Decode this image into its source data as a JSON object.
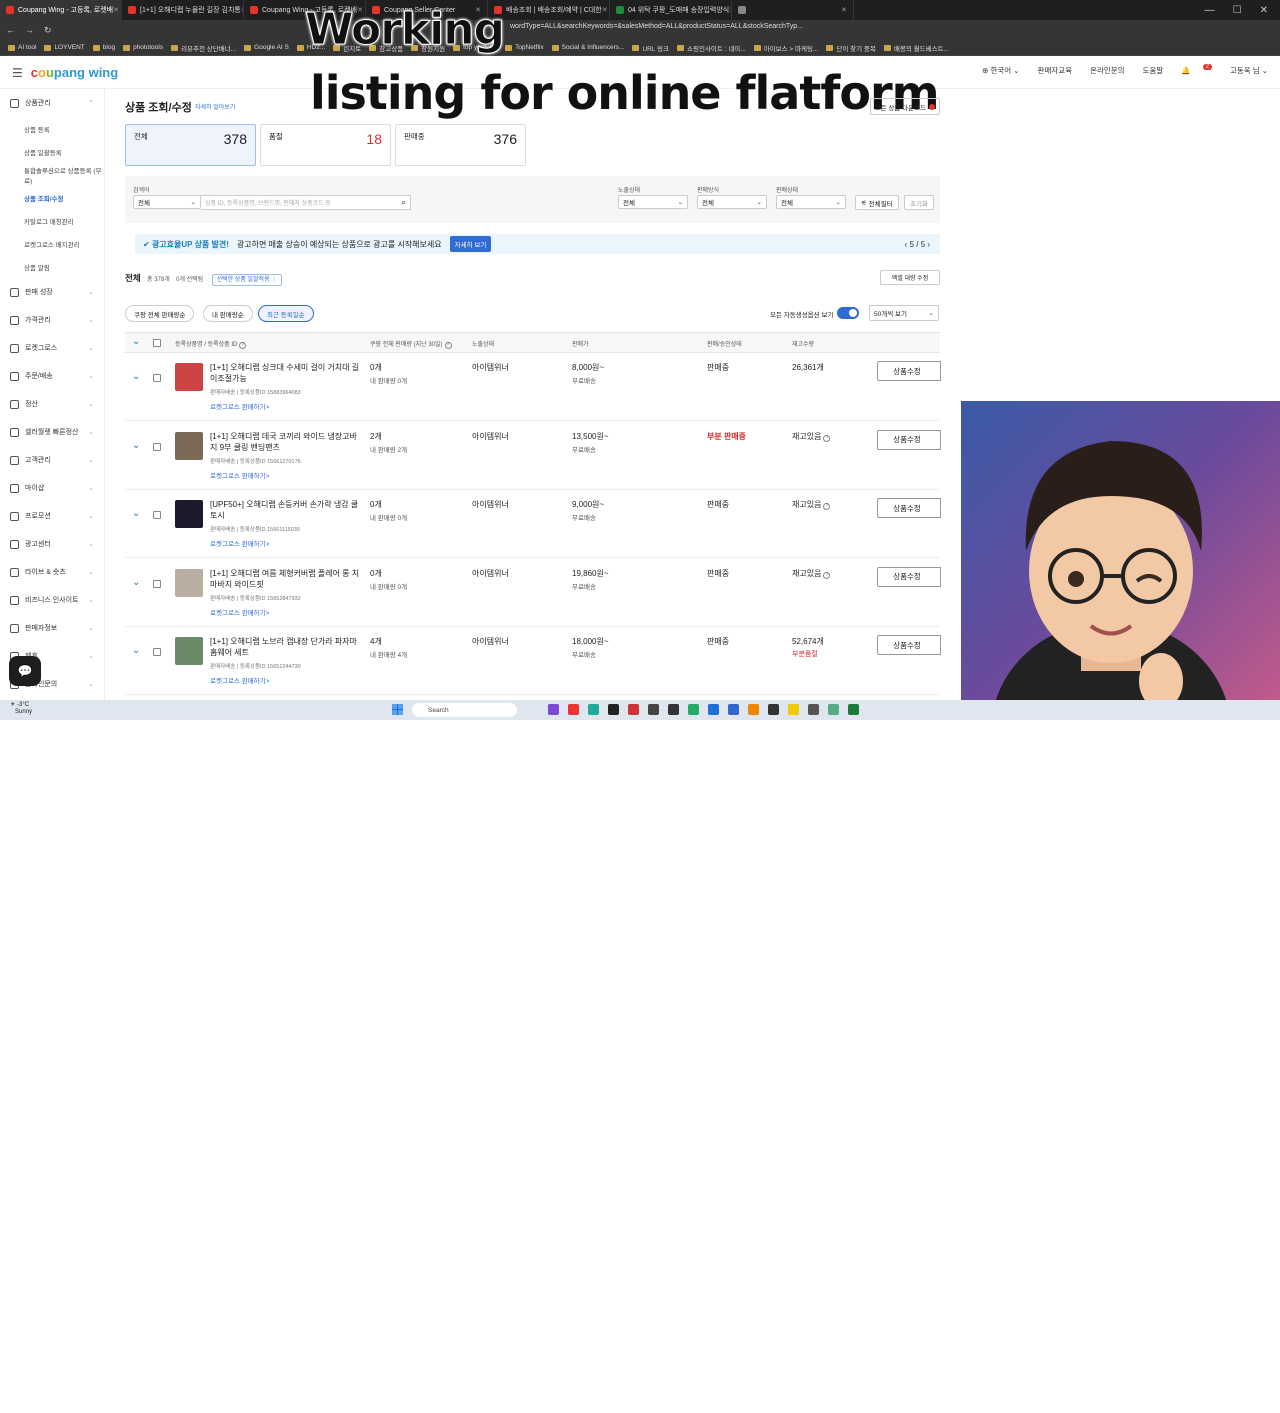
{
  "browser": {
    "tabs": [
      {
        "title": "Coupang Wing - 고등록, 로켓배",
        "color": "#e4332a",
        "active": true
      },
      {
        "title": "[1+1] 오해디랩 누물란 길장 김치통",
        "color": "#e4332a",
        "active": false
      },
      {
        "title": "Coupang Wing - 고등록, 로켓배",
        "color": "#e4332a",
        "active": false
      },
      {
        "title": "Coupang Seller Center",
        "color": "#e4332a",
        "active": false
      },
      {
        "title": "배송조회 | 배송조회/예약 | C대한",
        "color": "#e4332a",
        "active": false
      },
      {
        "title": "04 위탁 쿠팡_도매매 송장입력양식",
        "color": "#1e8e3e",
        "active": false
      },
      {
        "title": "",
        "color": "#888",
        "active": false
      }
    ],
    "url": "wordType=ALL&searchKeywords=&salesMethod=ALL&productStatus=ALL&stockSearchTyp...",
    "bookmarks": [
      "AI tool",
      "LOYVENT",
      "blog",
      "phototools",
      "리뷰추천 상단배너...",
      "Google AI S",
      "HD2...",
      "린지토",
      "참고상품",
      "창원지원",
      "top youtube",
      "TopNetflix",
      "Social & Influencers...",
      "URL 링크",
      "쇼핑인사이트 : 네이...",
      "아이보스 > 마케팅...",
      "단이 찾기 중복",
      "배봉의 월드베스트..."
    ]
  },
  "overlay": {
    "line1": "Working",
    "line2": "listing for online flatform"
  },
  "header": {
    "logo": {
      "c": "c",
      "o": "o",
      "u": "u",
      "pang": "pang",
      "wing": " wing"
    },
    "links": [
      "한국어",
      "판매자교육",
      "온라인문의",
      "도움말"
    ],
    "notifications": "2",
    "user": "고동욱 님"
  },
  "sidebar": {
    "groups": [
      {
        "label": "상품관리",
        "subs": [
          "상품 등록",
          "상품 일괄등록",
          "통합솔루션으로 상품등록 (무료)",
          "상품 조회/수정",
          "카탈로그 매칭관리",
          "로켓그로스 배지관리",
          "상품 알림"
        ],
        "active_sub": 3
      },
      {
        "label": "판매 성장"
      },
      {
        "label": "가격관리"
      },
      {
        "label": "로켓그로스"
      },
      {
        "label": "주문/배송"
      },
      {
        "label": "정산"
      },
      {
        "label": "셀러월렛 빠른정산"
      },
      {
        "label": "고객관리"
      },
      {
        "label": "마이샵"
      },
      {
        "label": "프로모션"
      },
      {
        "label": "광고센터"
      },
      {
        "label": "라이브 & 숏츠"
      },
      {
        "label": "비즈니스 인사이트"
      },
      {
        "label": "판매자정보"
      },
      {
        "label": "제휴"
      },
      {
        "label": "온라인문의"
      }
    ]
  },
  "page": {
    "title": "상품 조회/수정",
    "title_link": "자세히 알아보기",
    "top_button": "모든 상품 다운로드",
    "stats": [
      {
        "label": "전체",
        "value": "378"
      },
      {
        "label": "품절",
        "value": "18"
      },
      {
        "label": "판매중",
        "value": "376"
      }
    ],
    "filters": {
      "keyword_label": "검색어",
      "keyword_type": "전체",
      "search_placeholder": "상품 ID, 등록상품명, 브랜드명, 판매자 상품코드 등",
      "exposure_label": "노출상태",
      "exposure": "전체",
      "method_label": "판매방식",
      "method": "전체",
      "status_label": "판매상태",
      "status": "전체",
      "detail_filter": "전체필터",
      "reset": "초기화"
    },
    "banner": {
      "highlight": "광고효율UP 상품 발견!",
      "text": "광고하면 매출 상승이 예상되는 상품으로 광고를 시작해보세요",
      "button": "자세히 보기",
      "pager": "5 / 5"
    },
    "list": {
      "title": "전체",
      "count": "총 378개",
      "selected": "0개 선택됨",
      "bulk": "선택한 상품 일괄적용",
      "excel": "엑셀 대량 수정",
      "pills": [
        "쿠팡 전체 판매량순",
        "내 판매량순",
        "최근 등록일순"
      ],
      "active_pill": 2,
      "toggle_label": "모든 자동생성옵션 보기",
      "per_page": "50개씩 보기"
    },
    "columns": [
      "등록상품명 / 등록상품 ID",
      "쿠팡 전체 판매량 (지난 30일)",
      "노출상태",
      "판매가",
      "판매/승인상태",
      "재고수량"
    ],
    "rows": [
      {
        "name": "[1+1] 오해디랩 싱크대 수세미 걸이 거치대 길이조절가능",
        "seller": "판매자배송",
        "pid": "등록상품ID 15883964083",
        "rocket": "로켓그로스 판매하기>",
        "sales": "0개",
        "my_sales": "내 판매량 0개",
        "exposure": "아이템위너",
        "price": "8,000원~",
        "ship": "무료배송",
        "status": "판매중",
        "status_red": false,
        "stock": "26,361개",
        "stock_note": "",
        "edit": "상품수정",
        "thumb": "#c44"
      },
      {
        "name": "[1+1] 오해디랩 데국 코끼리 와이드 냉장고바지 9부 쿨링 밴딩팬츠",
        "seller": "판매자배송",
        "pid": "등록상품ID 15661270176",
        "rocket": "로켓그로스 판매하기>",
        "sales": "2개",
        "my_sales": "내 판매량 2개",
        "exposure": "아이템위너",
        "price": "13,500원~",
        "ship": "무료배송",
        "status": "부분 판매중",
        "status_red": true,
        "stock": "재고있음",
        "stock_note": "",
        "edit": "상품수정",
        "thumb": "#7a6a55"
      },
      {
        "name": "[UPF50+] 오해디랩 손등커버 손가락 냉감 쿨토시",
        "seller": "판매자배송",
        "pid": "등록상품ID 15661115035",
        "rocket": "로켓그로스 판매하기>",
        "sales": "0개",
        "my_sales": "내 판매량 0개",
        "exposure": "아이템위너",
        "price": "9,000원~",
        "ship": "무료배송",
        "status": "판매중",
        "status_red": false,
        "stock": "재고있음",
        "stock_note": "",
        "edit": "상품수정",
        "thumb": "#1a1a2a"
      },
      {
        "name": "[1+1] 오해디랩 여름 체형커버랩 플레어 롱 치마바지 와이드핏",
        "seller": "판매자배송",
        "pid": "등록상품ID 15652847932",
        "rocket": "로켓그로스 판매하기>",
        "sales": "0개",
        "my_sales": "내 판매량 0개",
        "exposure": "아이템위너",
        "price": "19,860원~",
        "ship": "무료배송",
        "status": "판매중",
        "status_red": false,
        "stock": "재고있음",
        "stock_note": "",
        "edit": "상품수정",
        "thumb": "#b8ada0"
      },
      {
        "name": "[1+1] 오해디랩 노브라 캡내장 단가라 파자마 홈웨어 세트",
        "seller": "판매자배송",
        "pid": "등록상품ID 15651244730",
        "rocket": "로켓그로스 판매하기>",
        "sales": "4개",
        "my_sales": "내 판매량 4개",
        "exposure": "아이템위너",
        "price": "18,000원~",
        "ship": "무료배송",
        "status": "판매중",
        "status_red": false,
        "stock": "52,674개",
        "stock_note": "부분품절",
        "edit": "상품수정",
        "thumb": "#6a8a6a"
      }
    ]
  },
  "taskbar": {
    "weather_temp": "-3°C",
    "weather_text": "Sunny",
    "search": "Search"
  }
}
